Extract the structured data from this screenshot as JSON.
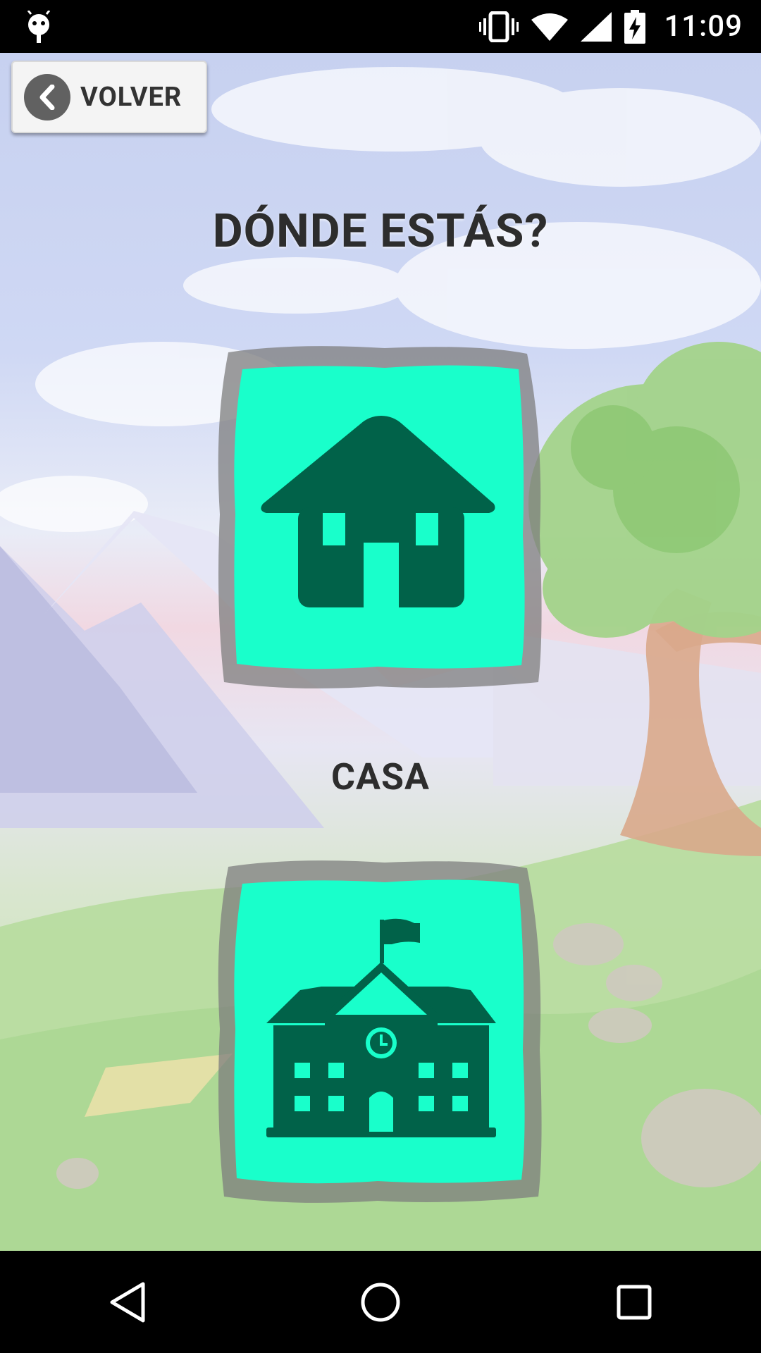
{
  "status_bar": {
    "time": "11:09",
    "icons": [
      "android-debug-icon",
      "vibrate-icon",
      "wifi-icon",
      "cell-signal-icon",
      "battery-charging-icon"
    ]
  },
  "toolbar": {
    "back_label": "VOLVER",
    "back_icon": "chevron-left-icon"
  },
  "page": {
    "title": "DÓNDE ESTÁS?"
  },
  "options": [
    {
      "label": "CASA",
      "icon": "house-icon"
    },
    {
      "label": "",
      "icon": "school-icon"
    }
  ],
  "nav_bar": {
    "icons": [
      "back-triangle-icon",
      "home-circle-icon",
      "recents-square-icon"
    ]
  },
  "colors": {
    "tile_fill": "#19ffcb",
    "tile_border": "#7d7d7d",
    "icon_fill": "#016249",
    "title_text": "#2d2d2d"
  }
}
